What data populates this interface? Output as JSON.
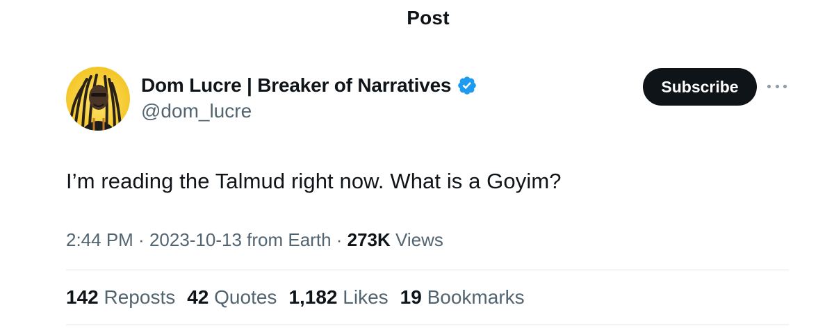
{
  "header": {
    "title": "Post"
  },
  "author": {
    "display_name": "Dom Lucre | Breaker of Narratives",
    "handle": "@dom_lucre",
    "verified_badge_icon": "verified-badge-icon",
    "avatar_icon": "avatar-photo"
  },
  "actions": {
    "subscribe_label": "Subscribe",
    "more_icon": "more-horizontal-icon"
  },
  "post": {
    "text": "I’m reading the Talmud right now. What is a Goyim?"
  },
  "meta": {
    "time": "2:44 PM",
    "sep1": " · ",
    "date": "2023-10-13",
    "location": " from Earth",
    "sep2": " · ",
    "views_count": "273K",
    "views_label": " Views"
  },
  "stats": {
    "reposts_count": "142",
    "reposts_label": "Reposts",
    "quotes_count": "42",
    "quotes_label": "Quotes",
    "likes_count": "1,182",
    "likes_label": "Likes",
    "bookmarks_count": "19",
    "bookmarks_label": "Bookmarks"
  },
  "colors": {
    "primary_text": "#0f1419",
    "secondary_text": "#536471",
    "verified_blue": "#1d9bf0",
    "button_bg": "#0f1419",
    "divider": "#e1e6ea"
  }
}
